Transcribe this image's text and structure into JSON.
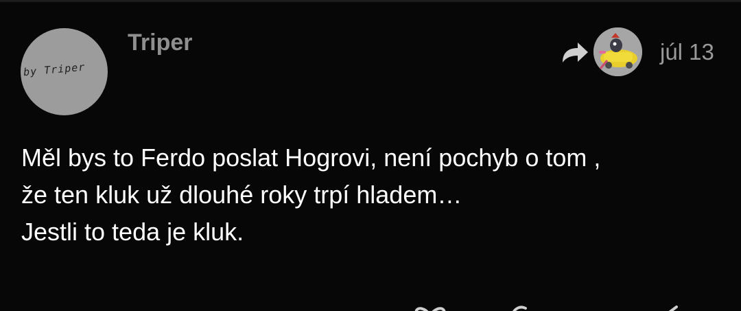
{
  "post": {
    "author": {
      "name": "Triper",
      "avatar_text": "by Triper"
    },
    "reply_to": {
      "icon": "reply-arrow-icon",
      "avatar": "reply-user-avatar"
    },
    "date": "júl 13",
    "body": {
      "lines": [
        "Měl bys to Ferdo poslat Hogrovi, není pochyb o tom ,",
        "že ten kluk už dlouhé roky trpí hladem…",
        "Jestli to teda je kluk."
      ]
    },
    "actions": {
      "icons": [
        "heart-icon",
        "link-icon",
        "share-icon"
      ]
    }
  },
  "colors": {
    "background": "#070707",
    "username": "#8f8f8f",
    "date": "#9a9a9a",
    "text": "#ffffff",
    "avatar_bg": "#9c9c9c"
  }
}
